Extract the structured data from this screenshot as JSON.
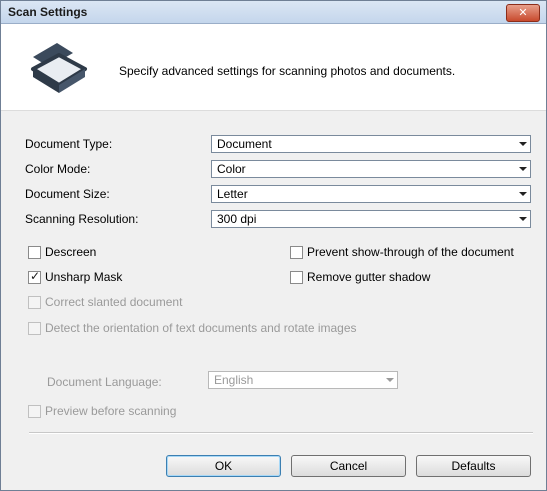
{
  "window": {
    "title": "Scan Settings",
    "close_glyph": "✕"
  },
  "header": {
    "description": "Specify advanced settings for scanning photos and documents.",
    "icon": "scanner-icon"
  },
  "fields": {
    "document_type": {
      "label": "Document Type:",
      "value": "Document"
    },
    "color_mode": {
      "label": "Color Mode:",
      "value": "Color"
    },
    "document_size": {
      "label": "Document Size:",
      "value": "Letter"
    },
    "scanning_resolution": {
      "label": "Scanning Resolution:",
      "value": "300 dpi"
    }
  },
  "options": {
    "descreen": {
      "label": "Descreen",
      "checked": false,
      "enabled": true
    },
    "unsharp_mask": {
      "label": "Unsharp Mask",
      "checked": true,
      "enabled": true
    },
    "prevent_show_through": {
      "label": "Prevent show-through of the document",
      "checked": false,
      "enabled": true
    },
    "remove_gutter_shadow": {
      "label": "Remove gutter shadow",
      "checked": false,
      "enabled": true
    },
    "correct_slanted": {
      "label": "Correct slanted document",
      "checked": false,
      "enabled": false
    },
    "detect_orientation": {
      "label": "Detect the orientation of text documents and rotate images",
      "checked": false,
      "enabled": false
    },
    "preview_before_scanning": {
      "label": "Preview before scanning",
      "checked": false,
      "enabled": false
    }
  },
  "document_language": {
    "label": "Document Language:",
    "value": "English",
    "enabled": false
  },
  "buttons": {
    "ok": "OK",
    "cancel": "Cancel",
    "defaults": "Defaults"
  },
  "check_glyph": "✓"
}
